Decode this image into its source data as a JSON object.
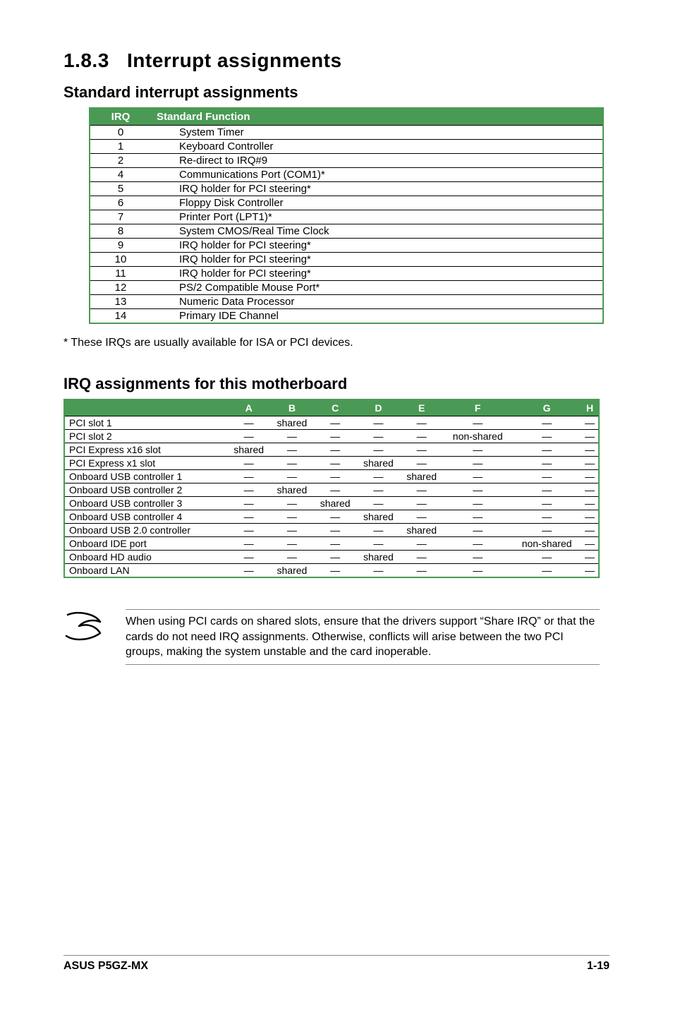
{
  "section": {
    "number": "1.8.3",
    "title": "Interrupt assignments",
    "sub1": "Standard interrupt assignments",
    "sub2": "IRQ assignments for this motherboard"
  },
  "std_table": {
    "headers": {
      "irq": "IRQ",
      "func": "Standard Function"
    },
    "rows": [
      {
        "irq": "0",
        "func": "System Timer"
      },
      {
        "irq": "1",
        "func": "Keyboard Controller"
      },
      {
        "irq": "2",
        "func": "Re-direct to IRQ#9"
      },
      {
        "irq": "4",
        "func": "Communications Port (COM1)*"
      },
      {
        "irq": "5",
        "func": "IRQ holder for PCI steering*"
      },
      {
        "irq": "6",
        "func": "Floppy Disk Controller"
      },
      {
        "irq": "7",
        "func": "Printer Port (LPT1)*"
      },
      {
        "irq": "8",
        "func": "System CMOS/Real Time Clock"
      },
      {
        "irq": "9",
        "func": "IRQ holder for PCI steering*"
      },
      {
        "irq": "10",
        "func": "IRQ holder for PCI steering*"
      },
      {
        "irq": "11",
        "func": "IRQ holder for PCI steering*"
      },
      {
        "irq": "12",
        "func": "PS/2 Compatible Mouse Port*"
      },
      {
        "irq": "13",
        "func": "Numeric Data Processor"
      },
      {
        "irq": "14",
        "func": "Primary IDE Channel"
      }
    ]
  },
  "std_note": "* These IRQs are usually available for ISA or PCI devices.",
  "mb_table": {
    "headers": [
      "",
      "A",
      "B",
      "C",
      "D",
      "E",
      "F",
      "G",
      "H"
    ],
    "rows": [
      {
        "name": "PCI slot 1",
        "vals": [
          "—",
          "shared",
          "—",
          "—",
          "—",
          "—",
          "—",
          "—"
        ]
      },
      {
        "name": "PCI slot 2",
        "vals": [
          "—",
          "—",
          "—",
          "—",
          "—",
          "non-shared",
          "—",
          "—"
        ]
      },
      {
        "name": "PCI Express x16 slot",
        "vals": [
          "shared",
          "—",
          "—",
          "—",
          "—",
          "—",
          "—",
          "—"
        ]
      },
      {
        "name": "PCI Express x1 slot",
        "vals": [
          "—",
          "—",
          "—",
          "shared",
          "—",
          "—",
          "—",
          "—"
        ]
      },
      {
        "name": "Onboard USB controller 1",
        "vals": [
          "—",
          "—",
          "—",
          "—",
          "shared",
          "—",
          "—",
          "—"
        ]
      },
      {
        "name": "Onboard USB controller 2",
        "vals": [
          "—",
          "shared",
          "—",
          "—",
          "—",
          "—",
          "—",
          "—"
        ]
      },
      {
        "name": "Onboard USB controller 3",
        "vals": [
          "—",
          "—",
          "shared",
          "—",
          "—",
          "—",
          "—",
          "—"
        ]
      },
      {
        "name": "Onboard USB controller 4",
        "vals": [
          "—",
          "—",
          "—",
          "shared",
          "—",
          "—",
          "—",
          "—"
        ]
      },
      {
        "name": "Onboard USB 2.0 controller",
        "vals": [
          "—",
          "—",
          "—",
          "—",
          "shared",
          "—",
          "—",
          "—"
        ]
      },
      {
        "name": "Onboard IDE port",
        "vals": [
          "—",
          "—",
          "—",
          "—",
          "—",
          "—",
          "non-shared",
          "—"
        ]
      },
      {
        "name": "Onboard HD audio",
        "vals": [
          "—",
          "—",
          "—",
          "shared",
          "—",
          "—",
          "—",
          "—"
        ]
      },
      {
        "name": "Onboard LAN",
        "vals": [
          "—",
          "shared",
          "—",
          "—",
          "—",
          "—",
          "—",
          "—"
        ]
      }
    ]
  },
  "callout_text": "When using PCI cards on shared slots, ensure that the drivers support “Share IRQ” or that the cards do not need IRQ assignments. Otherwise, conflicts will arise between the two PCI groups, making the system unstable and the card inoperable.",
  "footer": {
    "left": "ASUS P5GZ-MX",
    "right": "1-19"
  }
}
